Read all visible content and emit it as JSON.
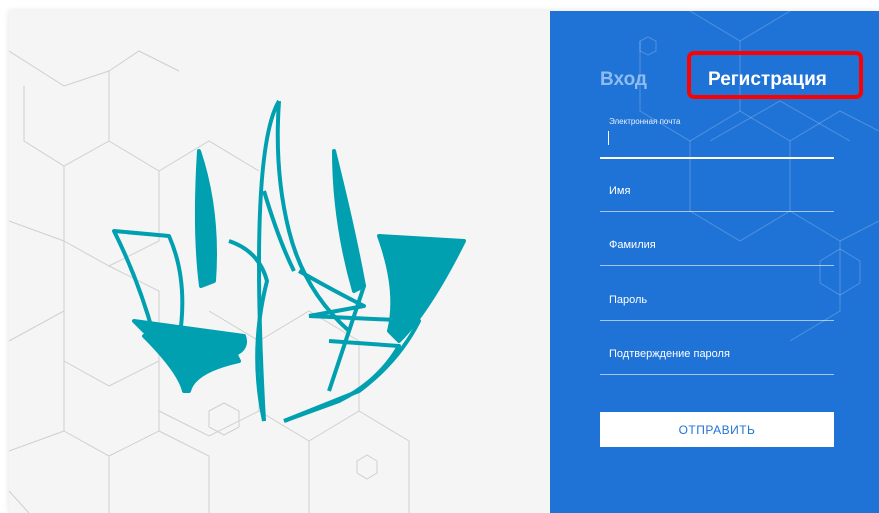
{
  "tabs": {
    "login_label": "Вход",
    "register_label": "Регистрация"
  },
  "form": {
    "email_label": "Электронная почта",
    "first_name_placeholder": "Имя",
    "last_name_placeholder": "Фамилия",
    "password_placeholder": "Пароль",
    "password_confirm_placeholder": "Подтверждение пароля",
    "submit_label": "ОТПРАВИТЬ"
  },
  "colors": {
    "panel_blue": "#1f73d6",
    "logo_teal": "#00a0b0",
    "left_background": "#f5f5f5",
    "highlight_red": "#ff0000"
  },
  "icons": {
    "logo": "open-book-flame-logo"
  }
}
